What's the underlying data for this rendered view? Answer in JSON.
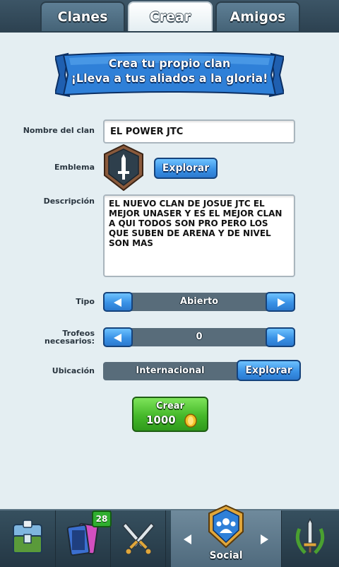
{
  "tabs": [
    {
      "label": "Clanes",
      "active": false
    },
    {
      "label": "Crear",
      "active": true
    },
    {
      "label": "Amigos",
      "active": false
    }
  ],
  "banner": {
    "line1": "Crea tu propio clan",
    "line2": "¡Lleva a tus aliados a la gloria!"
  },
  "form": {
    "nombre": {
      "label": "Nombre del clan",
      "value": "EL POWER JTC"
    },
    "emblema": {
      "label": "Emblema",
      "button": "Explorar",
      "icon": "shield-sword-icon"
    },
    "descripcion": {
      "label": "Descripción",
      "value": "EL NUEVO CLAN DE JOSUE JTC EL MEJOR UNASER Y ES EL MEJOR CLAN A QUI TODOS SON PRO PERO LOS QUE SUBEN DE ARENA Y DE NIVEL SON MAS"
    },
    "tipo": {
      "label": "Tipo",
      "value": "Abierto"
    },
    "trofeos": {
      "label_line1": "Trofeos",
      "label_line2": "necesarios:",
      "value": "0"
    },
    "ubicacion": {
      "label": "Ubicación",
      "value": "Internacional",
      "button": "Explorar"
    },
    "crear": {
      "label": "Crear",
      "cost": "1000",
      "currency_icon": "gold-coin-icon"
    }
  },
  "bottom_nav": {
    "items": [
      {
        "name": "shop",
        "icon": "chest-icon"
      },
      {
        "name": "cards",
        "icon": "cards-icon",
        "badge": "28"
      },
      {
        "name": "battle",
        "icon": "crossed-swords-icon"
      },
      {
        "name": "social",
        "icon": "social-shield-icon",
        "label": "Social",
        "active": true
      },
      {
        "name": "tournaments",
        "icon": "laurel-sword-icon"
      }
    ]
  },
  "colors": {
    "background": "#e4eef2",
    "blue_button": "#3a92e6",
    "green_button": "#45b82a",
    "banner_blue": "#2f80d8"
  }
}
